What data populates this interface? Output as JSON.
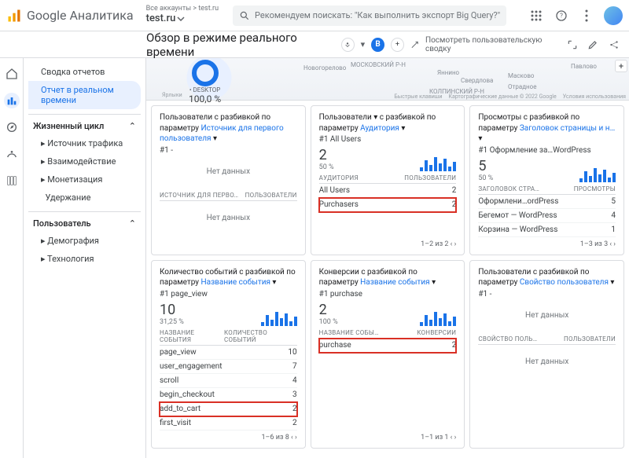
{
  "header": {
    "brand": "Аналитика",
    "account_path": "Все аккаунты > test.ru",
    "property": "test.ru",
    "search_placeholder": "Рекомендуем поискать: \"Как выполнить экспорт Big Query?\""
  },
  "subheader": {
    "title": "Обзор в режиме реального времени",
    "compare_chip": "B",
    "right_link": "Посмотреть пользовательскую сводку"
  },
  "sidebar": {
    "summary": "Сводка отчетов",
    "realtime": "Отчет в реальном времени",
    "sections": [
      {
        "label": "Жизненный цикл",
        "items": [
          "Источник трафика",
          "Взаимодействие",
          "Монетизация",
          "Удержание"
        ]
      },
      {
        "label": "Пользователь",
        "items": [
          "Демография",
          "Технология"
        ]
      }
    ]
  },
  "map": {
    "donut_label": "DESKTOP",
    "donut_value": "100,0 %",
    "places": [
      "Новогорелово",
      "МОСКОВСКИЙ Р-Н",
      "Яннино",
      "Свердлова",
      "КОЛПИНСКИЙ Р-Н",
      "Масково",
      "Отрадное",
      "Павлово"
    ],
    "scale": "Ярлыки",
    "footer": [
      "Быстрые клавиши",
      "Картографические данные © 2022 Google",
      "Условия использования"
    ]
  },
  "cards": [
    {
      "title_prefix": "Пользователи с разбивкой по параметру ",
      "param": "Источник для первого пользователя",
      "sub": "#1  -",
      "nodata": "Нет данных",
      "thead": [
        "ИСТОЧНИК ДЛЯ ПЕРВО…",
        "ПОЛЬЗОВАТЕЛИ"
      ],
      "nodata2": "Нет данных"
    },
    {
      "title_prefix": "Пользователи ▾ с разбивкой по параметру ",
      "param": "Аудитория",
      "sub": "#1  All Users",
      "metric": "2",
      "pct": "50 %",
      "thead": [
        "АУДИТОРИЯ",
        "ПОЛЬЗОВАТЕЛИ"
      ],
      "rows": [
        {
          "k": "All Users",
          "v": "2"
        },
        {
          "k": "Purchasers",
          "v": "2",
          "hl": true
        }
      ],
      "foot": "1–2 из 2  ‹  ›"
    },
    {
      "title_prefix": "Просмотры с разбивкой по параметру ",
      "param": "Заголовок страницы и н…",
      "sub": "#1  Оформление за…WordPress",
      "metric": "5",
      "pct": "50 %",
      "thead": [
        "ЗАГОЛОВОК СТРА…",
        "ПРОСМОТРЫ"
      ],
      "rows": [
        {
          "k": "Оформлени…ordPress",
          "v": "5"
        },
        {
          "k": "Бегемот — WordPress",
          "v": "4"
        },
        {
          "k": "Корзина — WordPress",
          "v": "1"
        }
      ],
      "foot": "1–3 из 3  ‹  ›"
    },
    {
      "title_prefix": "Количество событий с разбивкой по параметру ",
      "param": "Название события",
      "sub": "#1  page_view",
      "metric": "10",
      "pct": "31,25 %",
      "thead": [
        "НАЗВАНИЕ СОБЫТИЯ",
        "КОЛИЧЕСТВО СОБЫТИЙ"
      ],
      "rows": [
        {
          "k": "page_view",
          "v": "10"
        },
        {
          "k": "user_engagement",
          "v": "7"
        },
        {
          "k": "scroll",
          "v": "4"
        },
        {
          "k": "begin_checkout",
          "v": "3"
        },
        {
          "k": "add_to_cart",
          "v": "2",
          "hl": true
        },
        {
          "k": "first_visit",
          "v": "2"
        }
      ],
      "foot": "1–6 из 8  ‹  ›"
    },
    {
      "title_prefix": "Конверсии с разбивкой по параметру ",
      "param": "Название события",
      "sub": "#1  purchase",
      "metric": "2",
      "pct": "100 %",
      "thead": [
        "НАЗВАНИЕ СОБЫ…",
        "КОНВЕРСИИ"
      ],
      "rows": [
        {
          "k": "purchase",
          "v": "2",
          "hl": true
        }
      ],
      "foot": "1–1 из 1  ‹  ›"
    },
    {
      "title_prefix": "Пользователи с разбивкой по параметру ",
      "param": "Свойство пользователя",
      "sub": "#1  -",
      "nodata": "Нет данных",
      "thead": [
        "СВОЙСТВО ПОЛЬ…",
        "ПОЛЬЗОВАТЕЛИ"
      ],
      "nodata2": "Нет данных"
    }
  ]
}
